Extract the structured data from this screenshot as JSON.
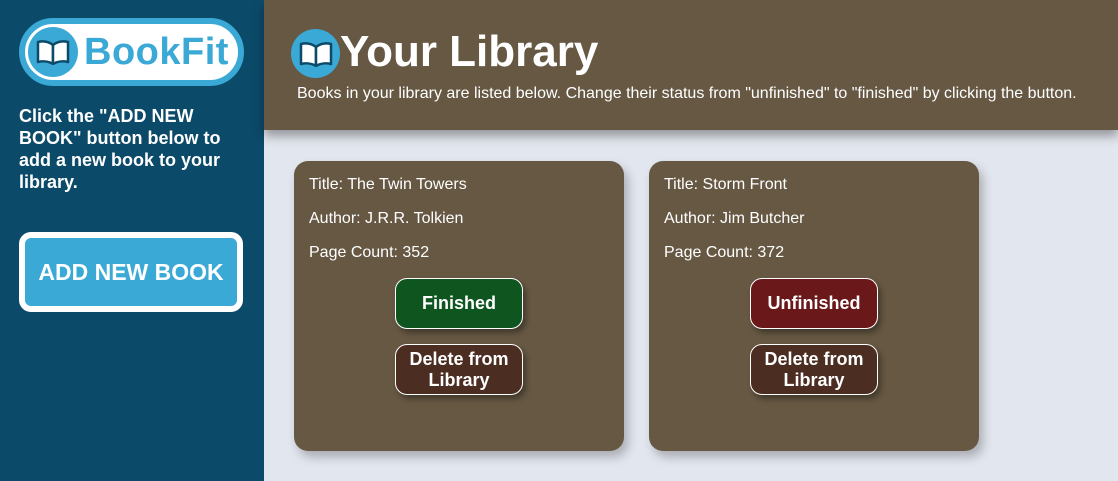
{
  "brand": {
    "name": "BookFit",
    "icon": "open-book-icon"
  },
  "sidebar": {
    "instructions": "Click the \"ADD NEW BOOK\" button below to add a new book to your library.",
    "add_button_label": "ADD NEW BOOK"
  },
  "header": {
    "icon": "open-book-icon",
    "title": "Your Library",
    "subtitle": "Books in your library are listed below. Change their status from \"unfinished\" to \"finished\" by clicking the button."
  },
  "books": [
    {
      "title": "Title: The Twin Towers",
      "author": "Author: J.R.R. Tolkien",
      "pages": "Page Count: 352",
      "status_label": "Finished",
      "delete_label": "Delete from Library"
    },
    {
      "title": "Title: Storm Front",
      "author": "Author: Jim Butcher",
      "pages": "Page Count: 372",
      "status_label": "Unfinished",
      "delete_label": "Delete from Library"
    }
  ],
  "colors": {
    "sidebar_bg": "#0c4a6a",
    "accent": "#3aa9d6",
    "header_bg": "#665843",
    "finished": "#0e5520",
    "unfinished": "#6b181b",
    "delete": "#4b2d22"
  }
}
